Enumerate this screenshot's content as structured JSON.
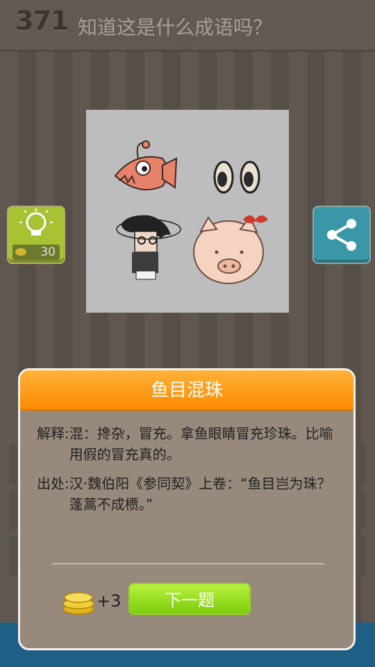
{
  "header": {
    "level": "371",
    "question": "知道这是什么成语吗？"
  },
  "hint": {
    "cost": "30"
  },
  "result": {
    "answer": "鱼目混珠",
    "explain_label": "解释:",
    "explain_text": "混：搀杂，冒充。拿鱼眼睛冒充珍珠。比喻用假的冒充真的。",
    "source_label": "出处:",
    "source_text": "汉·魏伯阳《参同契》上卷：“鱼目岂为珠？蓬蒿不成槚。”",
    "reward": "+3",
    "next_label": "下一题"
  },
  "colors": {
    "accent": "#fe8a00",
    "next_button": "#8fdc1f",
    "hint_button": "#a7c232",
    "share_button": "#3a97a8"
  }
}
